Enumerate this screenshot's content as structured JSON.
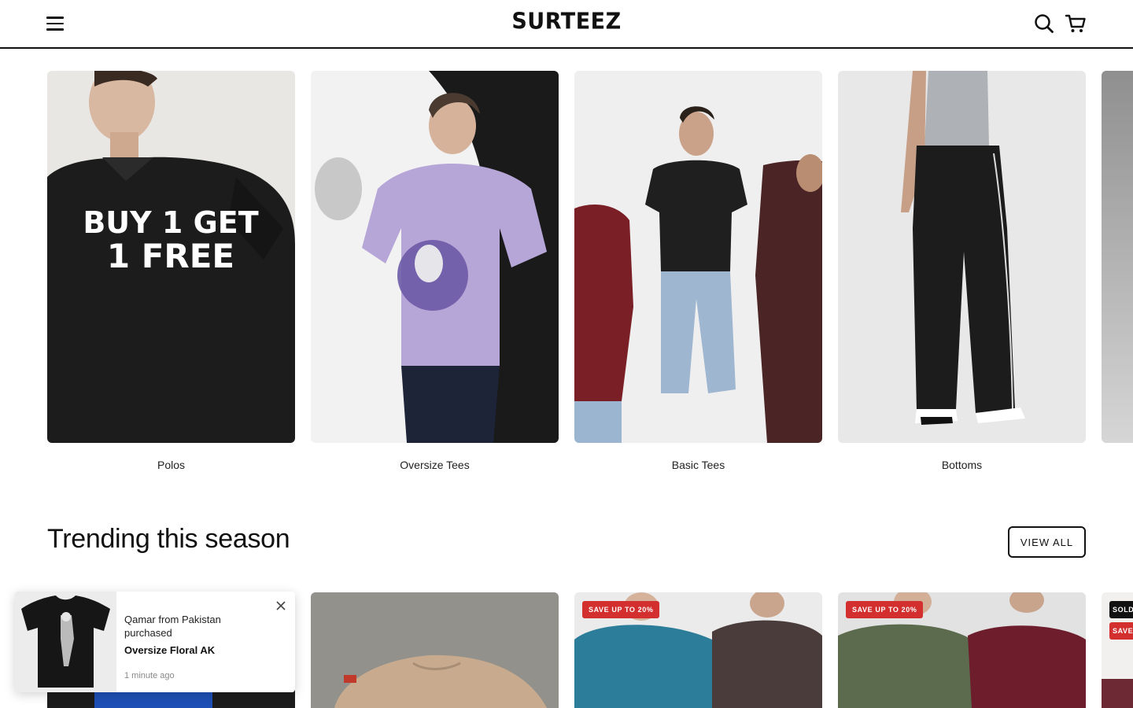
{
  "header": {
    "logo": "SURTEEZ",
    "menu_icon": "hamburger-menu-icon",
    "search_icon": "search-icon",
    "cart_icon": "cart-icon"
  },
  "collections": [
    {
      "label": "Polos",
      "promo_line1": "BUY 1 GET",
      "promo_line2": "1 FREE"
    },
    {
      "label": "Oversize Tees"
    },
    {
      "label": "Basic Tees"
    },
    {
      "label": "Bottoms"
    }
  ],
  "trending": {
    "title": "Trending this season",
    "view_all": "VIEW ALL",
    "products": [
      {
        "badges": []
      },
      {
        "badges": []
      },
      {
        "badges": [
          "SAVE UP TO 20%"
        ]
      },
      {
        "badges": [
          "SAVE UP TO 20%"
        ]
      },
      {
        "badges": [
          "SOLD",
          "SAVE"
        ]
      }
    ]
  },
  "toast": {
    "line1": "Qamar from Pakistan purchased",
    "product": "Oversize Floral AK",
    "time": "1 minute ago"
  },
  "colors": {
    "accent": "#111111",
    "sale_badge": "#d32f2f",
    "background": "#ffffff"
  }
}
